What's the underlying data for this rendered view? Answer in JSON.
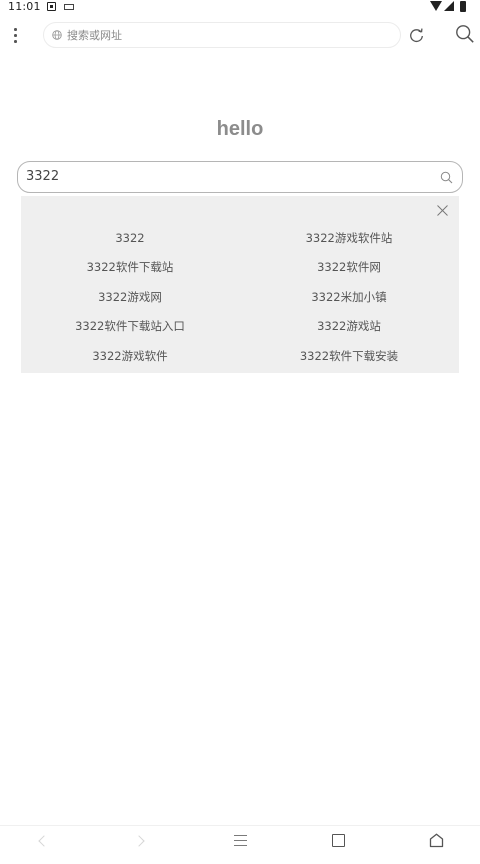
{
  "status_bar": {
    "time": "11:01"
  },
  "toolbar": {
    "address_placeholder": "搜索或网址"
  },
  "home": {
    "logo_text": "hello"
  },
  "search": {
    "value": "3322"
  },
  "suggestions": {
    "left": [
      "3322",
      "3322软件下载站",
      "3322游戏网",
      "3322软件下载站入口",
      "3322游戏软件"
    ],
    "right": [
      "3322游戏软件站",
      "3322软件网",
      "3322米加小镇",
      "3322游戏站",
      "3322软件下载安装"
    ]
  },
  "colors": {
    "page_background": "#ffffff",
    "suggestion_panel": "#efefef",
    "logo_text": "#8c8c8c"
  },
  "icons": [
    "menu-icon",
    "globe-icon",
    "reload-icon",
    "search-icon",
    "close-icon",
    "back-icon",
    "forward-icon",
    "menu-lines-icon",
    "tabs-icon",
    "home-icon"
  ]
}
